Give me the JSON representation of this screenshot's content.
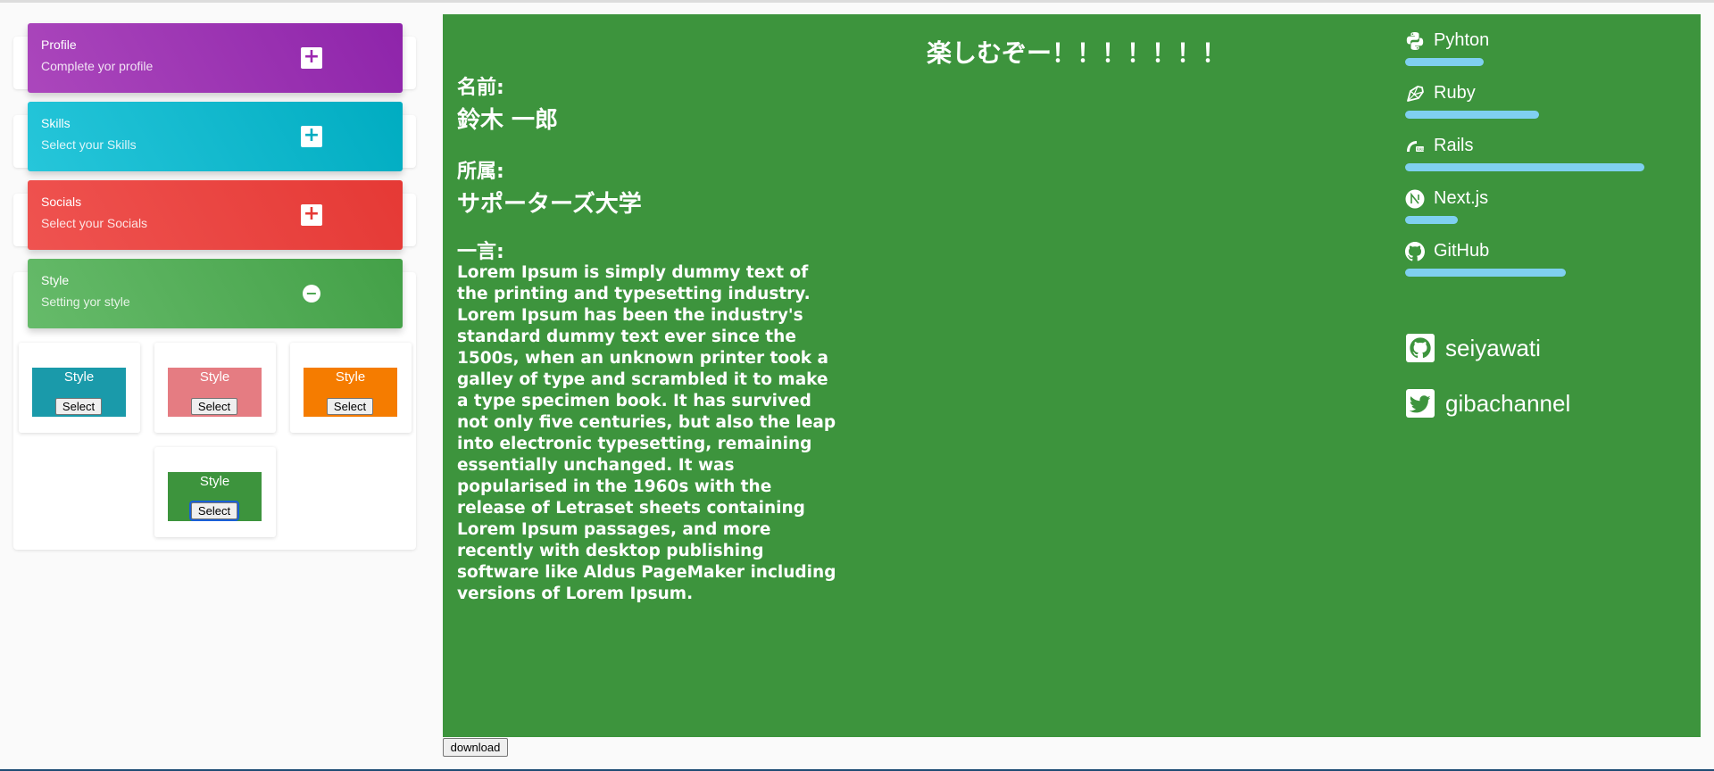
{
  "panel": {
    "sections": [
      {
        "title": "Profile",
        "subtitle": "Complete yor profile",
        "toggle": "+"
      },
      {
        "title": "Skills",
        "subtitle": "Select your Skills",
        "toggle": "+"
      },
      {
        "title": "Socials",
        "subtitle": "Select your Socials",
        "toggle": "+"
      },
      {
        "title": "Style",
        "subtitle": "Setting yor style",
        "toggle": "−"
      }
    ],
    "styles": [
      {
        "label": "Style",
        "button": "Select",
        "color": "#1a9aaa"
      },
      {
        "label": "Style",
        "button": "Select",
        "color": "#e57c82"
      },
      {
        "label": "Style",
        "button": "Select",
        "color": "#f57c00"
      },
      {
        "label": "Style",
        "button": "Select",
        "color": "#3d943d"
      }
    ]
  },
  "card": {
    "title": "楽しむぞー！！！！！！！",
    "background": "#3d943d",
    "name_label": "名前:",
    "name_value": "鈴木 一郎",
    "affiliation_label": "所属:",
    "affiliation_value": "サポーターズ大学",
    "comment_label": "一言:",
    "comment_value": "Lorem Ipsum is simply dummy text of the printing and typesetting industry. Lorem Ipsum has been the industry's standard dummy text ever since the 1500s, when an unknown printer took a galley of type and scrambled it to make a type specimen book. It has survived not only five centuries, but also the leap into electronic typesetting, remaining essentially unchanged. It was popularised in the 1960s with the release of Letraset sheets containing Lorem Ipsum passages, and more recently with desktop publishing software like Aldus PageMaker including versions of Lorem Ipsum.",
    "skills": [
      {
        "name": "Pyhton",
        "icon": "python-icon",
        "level": 0.33
      },
      {
        "name": "Ruby",
        "icon": "ruby-icon",
        "level": 0.56
      },
      {
        "name": "Rails",
        "icon": "rails-icon",
        "level": 1.0
      },
      {
        "name": "Next.js",
        "icon": "nextjs-icon",
        "level": 0.22
      },
      {
        "name": "GitHub",
        "icon": "github-icon",
        "level": 0.67
      }
    ],
    "bar_color": "#7fd0f0",
    "socials": [
      {
        "name": "seiyawati",
        "icon": "github-icon"
      },
      {
        "name": "gibachannel",
        "icon": "twitter-icon"
      }
    ]
  },
  "download_label": "download"
}
